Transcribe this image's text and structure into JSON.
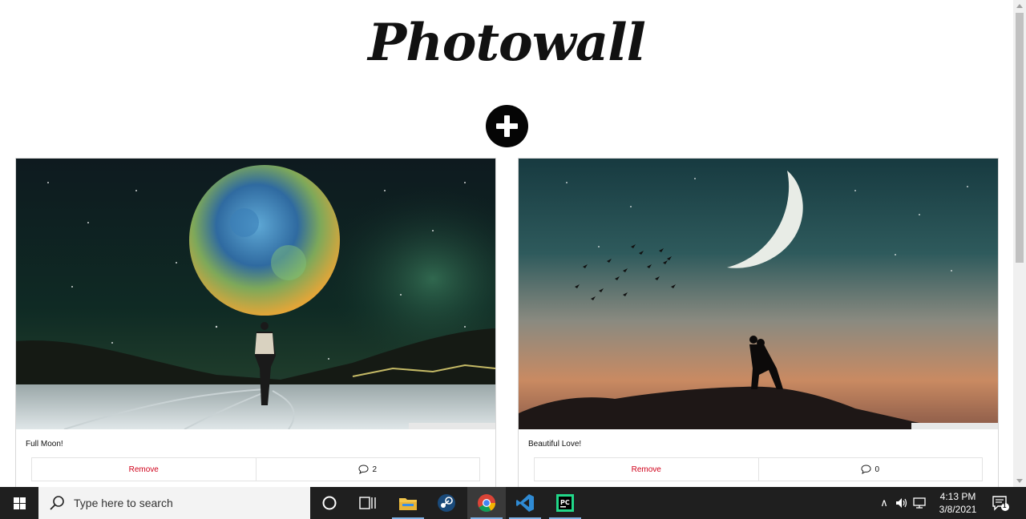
{
  "app": {
    "logo_text": "Photowall"
  },
  "posts": [
    {
      "caption": "Full Moon!",
      "remove_label": "Remove",
      "comment_count": "2"
    },
    {
      "caption": "Beautiful Love!",
      "remove_label": "Remove",
      "comment_count": "0"
    }
  ],
  "taskbar": {
    "search_placeholder": "Type here to search",
    "time": "4:13 PM",
    "date": "3/8/2021",
    "notification_count": "1",
    "pinned": [
      "task-view",
      "file-explorer",
      "steam",
      "chrome",
      "vscode",
      "pycharm"
    ]
  },
  "colors": {
    "remove": "#d0021b",
    "taskbar": "#1f1f1f",
    "accent": "#7fb2e6"
  }
}
